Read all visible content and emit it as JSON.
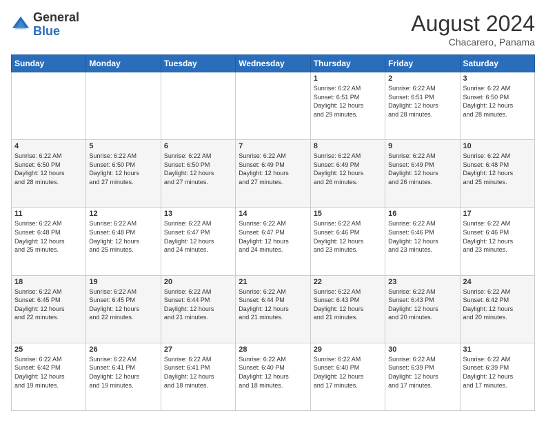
{
  "logo": {
    "general": "General",
    "blue": "Blue"
  },
  "title": {
    "month_year": "August 2024",
    "location": "Chacarero, Panama"
  },
  "days_of_week": [
    "Sunday",
    "Monday",
    "Tuesday",
    "Wednesday",
    "Thursday",
    "Friday",
    "Saturday"
  ],
  "weeks": [
    [
      {
        "day": "",
        "info": ""
      },
      {
        "day": "",
        "info": ""
      },
      {
        "day": "",
        "info": ""
      },
      {
        "day": "",
        "info": ""
      },
      {
        "day": "1",
        "info": "Sunrise: 6:22 AM\nSunset: 6:51 PM\nDaylight: 12 hours\nand 29 minutes."
      },
      {
        "day": "2",
        "info": "Sunrise: 6:22 AM\nSunset: 6:51 PM\nDaylight: 12 hours\nand 28 minutes."
      },
      {
        "day": "3",
        "info": "Sunrise: 6:22 AM\nSunset: 6:50 PM\nDaylight: 12 hours\nand 28 minutes."
      }
    ],
    [
      {
        "day": "4",
        "info": "Sunrise: 6:22 AM\nSunset: 6:50 PM\nDaylight: 12 hours\nand 28 minutes."
      },
      {
        "day": "5",
        "info": "Sunrise: 6:22 AM\nSunset: 6:50 PM\nDaylight: 12 hours\nand 27 minutes."
      },
      {
        "day": "6",
        "info": "Sunrise: 6:22 AM\nSunset: 6:50 PM\nDaylight: 12 hours\nand 27 minutes."
      },
      {
        "day": "7",
        "info": "Sunrise: 6:22 AM\nSunset: 6:49 PM\nDaylight: 12 hours\nand 27 minutes."
      },
      {
        "day": "8",
        "info": "Sunrise: 6:22 AM\nSunset: 6:49 PM\nDaylight: 12 hours\nand 26 minutes."
      },
      {
        "day": "9",
        "info": "Sunrise: 6:22 AM\nSunset: 6:49 PM\nDaylight: 12 hours\nand 26 minutes."
      },
      {
        "day": "10",
        "info": "Sunrise: 6:22 AM\nSunset: 6:48 PM\nDaylight: 12 hours\nand 25 minutes."
      }
    ],
    [
      {
        "day": "11",
        "info": "Sunrise: 6:22 AM\nSunset: 6:48 PM\nDaylight: 12 hours\nand 25 minutes."
      },
      {
        "day": "12",
        "info": "Sunrise: 6:22 AM\nSunset: 6:48 PM\nDaylight: 12 hours\nand 25 minutes."
      },
      {
        "day": "13",
        "info": "Sunrise: 6:22 AM\nSunset: 6:47 PM\nDaylight: 12 hours\nand 24 minutes."
      },
      {
        "day": "14",
        "info": "Sunrise: 6:22 AM\nSunset: 6:47 PM\nDaylight: 12 hours\nand 24 minutes."
      },
      {
        "day": "15",
        "info": "Sunrise: 6:22 AM\nSunset: 6:46 PM\nDaylight: 12 hours\nand 23 minutes."
      },
      {
        "day": "16",
        "info": "Sunrise: 6:22 AM\nSunset: 6:46 PM\nDaylight: 12 hours\nand 23 minutes."
      },
      {
        "day": "17",
        "info": "Sunrise: 6:22 AM\nSunset: 6:46 PM\nDaylight: 12 hours\nand 23 minutes."
      }
    ],
    [
      {
        "day": "18",
        "info": "Sunrise: 6:22 AM\nSunset: 6:45 PM\nDaylight: 12 hours\nand 22 minutes."
      },
      {
        "day": "19",
        "info": "Sunrise: 6:22 AM\nSunset: 6:45 PM\nDaylight: 12 hours\nand 22 minutes."
      },
      {
        "day": "20",
        "info": "Sunrise: 6:22 AM\nSunset: 6:44 PM\nDaylight: 12 hours\nand 21 minutes."
      },
      {
        "day": "21",
        "info": "Sunrise: 6:22 AM\nSunset: 6:44 PM\nDaylight: 12 hours\nand 21 minutes."
      },
      {
        "day": "22",
        "info": "Sunrise: 6:22 AM\nSunset: 6:43 PM\nDaylight: 12 hours\nand 21 minutes."
      },
      {
        "day": "23",
        "info": "Sunrise: 6:22 AM\nSunset: 6:43 PM\nDaylight: 12 hours\nand 20 minutes."
      },
      {
        "day": "24",
        "info": "Sunrise: 6:22 AM\nSunset: 6:42 PM\nDaylight: 12 hours\nand 20 minutes."
      }
    ],
    [
      {
        "day": "25",
        "info": "Sunrise: 6:22 AM\nSunset: 6:42 PM\nDaylight: 12 hours\nand 19 minutes."
      },
      {
        "day": "26",
        "info": "Sunrise: 6:22 AM\nSunset: 6:41 PM\nDaylight: 12 hours\nand 19 minutes."
      },
      {
        "day": "27",
        "info": "Sunrise: 6:22 AM\nSunset: 6:41 PM\nDaylight: 12 hours\nand 18 minutes."
      },
      {
        "day": "28",
        "info": "Sunrise: 6:22 AM\nSunset: 6:40 PM\nDaylight: 12 hours\nand 18 minutes."
      },
      {
        "day": "29",
        "info": "Sunrise: 6:22 AM\nSunset: 6:40 PM\nDaylight: 12 hours\nand 17 minutes."
      },
      {
        "day": "30",
        "info": "Sunrise: 6:22 AM\nSunset: 6:39 PM\nDaylight: 12 hours\nand 17 minutes."
      },
      {
        "day": "31",
        "info": "Sunrise: 6:22 AM\nSunset: 6:39 PM\nDaylight: 12 hours\nand 17 minutes."
      }
    ]
  ]
}
